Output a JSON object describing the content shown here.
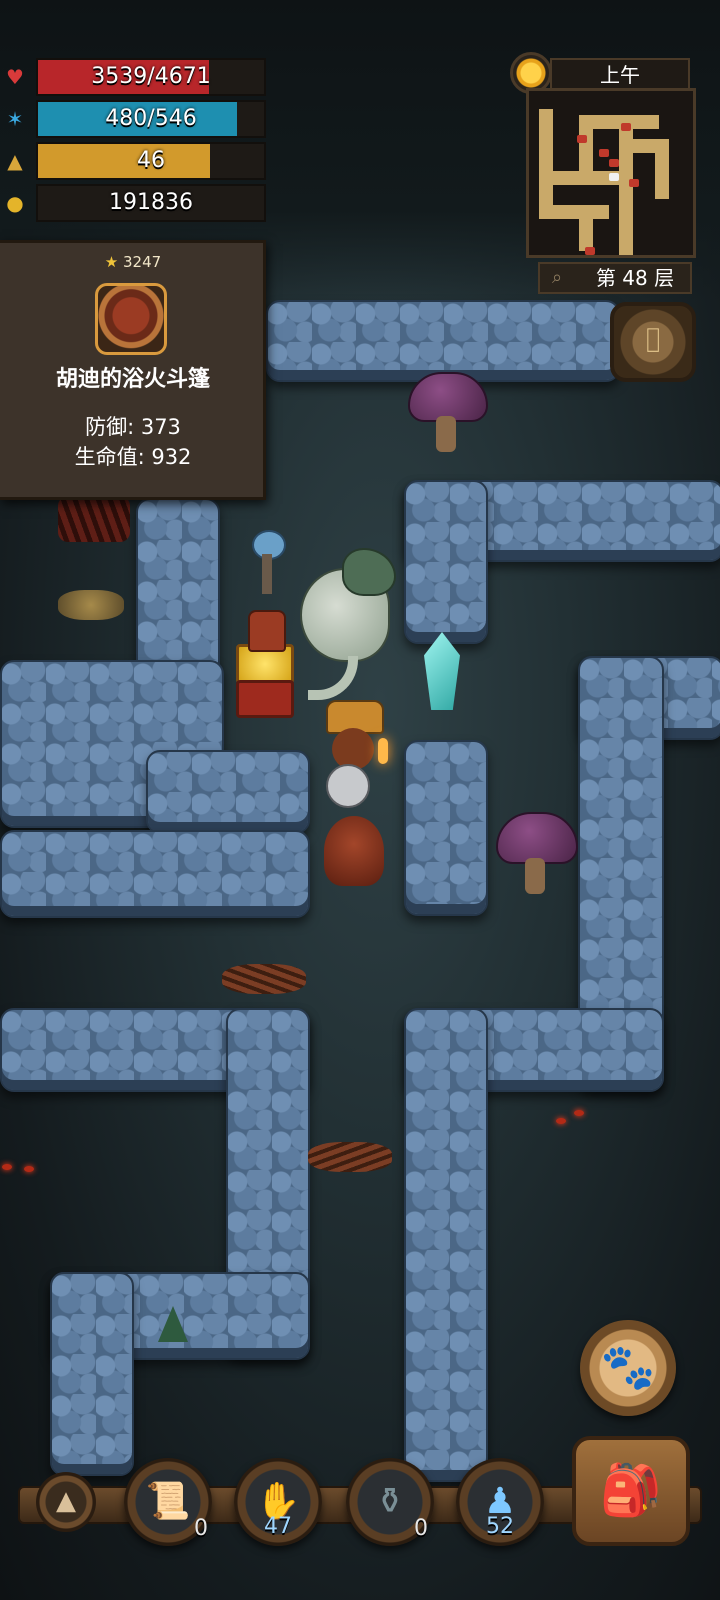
{
  "hud": {
    "hp": {
      "text": "3539/4671",
      "current": 3539,
      "max": 4671,
      "color": "#b8262a",
      "icon": "heart-icon"
    },
    "mp": {
      "text": "480/546",
      "current": 480,
      "max": 546,
      "color": "#1e8fb0",
      "icon": "magic-wand-icon"
    },
    "level": {
      "text": "46",
      "fill_fraction": 0.76,
      "color": "#d29a2c",
      "icon": "triangle-icon"
    },
    "gold": {
      "text": "191836",
      "icon": "gold-coins-icon"
    }
  },
  "tooltip": {
    "stars": "3247",
    "item_name": "胡迪的浴火斗篷",
    "defense": "防御: 373",
    "hp_bonus": "生命值: 932"
  },
  "clock": {
    "time_of_day": "上午",
    "icon": "sun-icon"
  },
  "minimap": {
    "floor_label": "第 48 层",
    "zoom_icon": "zoom-icon"
  },
  "toolbar": {
    "slot_scroll_count": "0",
    "slot_hand_count": "47",
    "slot_potion_count": "0",
    "slot_figure_count": "52"
  },
  "colors": {
    "wall": "#4b6786",
    "floor": "#2a383c",
    "panel": "#3d332a"
  }
}
